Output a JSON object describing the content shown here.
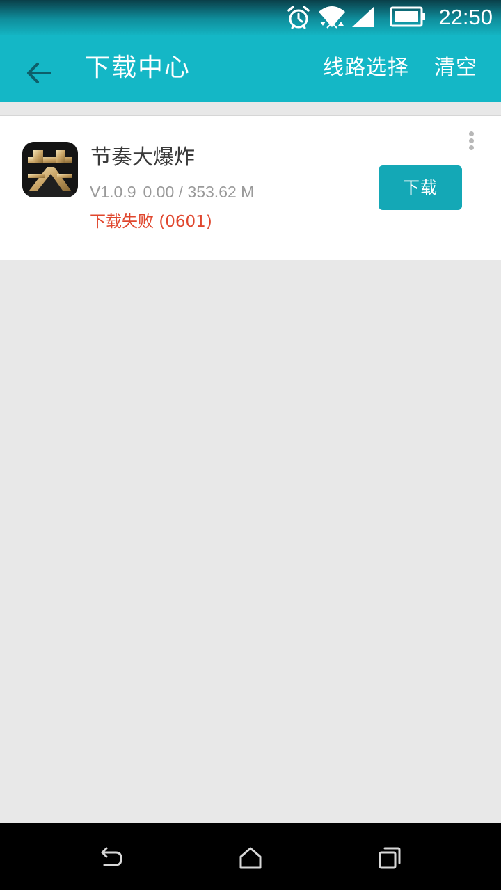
{
  "status_bar": {
    "time": "22:50",
    "icons": [
      "alarm-icon",
      "wifi-icon",
      "cell-signal-icon",
      "battery-icon"
    ]
  },
  "app_bar": {
    "title": "下载中心",
    "back_icon": "arrow-left-icon",
    "actions": {
      "route_select": "线路选择",
      "clear": "清空"
    }
  },
  "downloads": [
    {
      "name": "节奏大爆炸",
      "version": "V1.0.9",
      "progress": "0.00 / 353.62 M",
      "status": "下载失败 (0601)",
      "button_label": "下载",
      "icon": "beat-app-icon",
      "menu_icon": "more-vertical-icon"
    }
  ],
  "nav_bar": {
    "icons": [
      "back-nav-icon",
      "home-nav-icon",
      "recents-nav-icon"
    ]
  },
  "colors": {
    "accent": "#14b7c6",
    "button": "#14a8b6",
    "error": "#e0472e",
    "background": "#e8e8e8"
  }
}
